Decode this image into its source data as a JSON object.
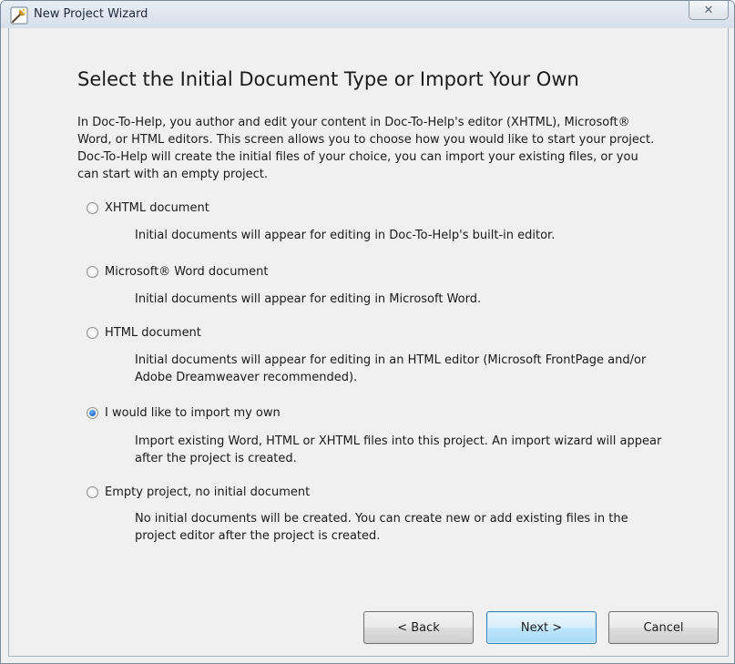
{
  "window": {
    "title": "New Project Wizard",
    "close_glyph": "✕"
  },
  "page": {
    "heading": "Select the Initial Document Type or Import Your Own",
    "intro": "In Doc-To-Help, you author and edit your content in Doc-To-Help's editor (XHTML), Microsoft® Word, or HTML editors. This screen allows you to choose how you would like to start your project. Doc-To-Help will create the initial files of your choice, you can import your existing files, or you can start with an empty project."
  },
  "options": [
    {
      "label": "XHTML document",
      "description": "Initial documents will appear for editing in Doc-To-Help's built-in editor.",
      "selected": false
    },
    {
      "label": "Microsoft® Word document",
      "description": "Initial documents will appear for editing in Microsoft Word.",
      "selected": false
    },
    {
      "label": "HTML document",
      "description": "Initial documents will appear for editing in an HTML editor (Microsoft FrontPage and/or Adobe Dreamweaver recommended).",
      "selected": false
    },
    {
      "label": "I would like to import my own",
      "description": "Import existing Word, HTML or XHTML files into this project. An import wizard will appear after the project is created.",
      "selected": true
    },
    {
      "label": "Empty project, no initial document",
      "description": "No initial documents will be created. You can create new or add existing files in the project editor after the project is created.",
      "selected": false
    }
  ],
  "buttons": {
    "back": "< Back",
    "next": "Next >",
    "cancel": "Cancel"
  },
  "icons": {
    "app": "wizard-app-icon",
    "close": "close-icon"
  },
  "colors": {
    "dialog_bg": "#f0f0f0",
    "selected_radio": "#1a67c9",
    "default_button_border": "#3c7fb1"
  }
}
